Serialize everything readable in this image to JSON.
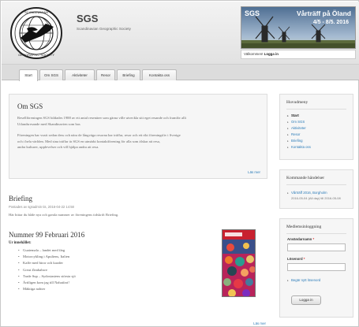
{
  "header": {
    "site_name": "SGS",
    "site_slogan": "Scandinavian Geographic Society",
    "logo_icon": "sgs-globe-logo",
    "banner": {
      "label": "SGS",
      "title": "Vårträff på Öland",
      "date": "4/5 - 8/5. 2016"
    },
    "welcome_text": "Välkommen!",
    "login_text": "Logga in"
  },
  "tabs": [
    {
      "label": "Start",
      "active": true
    },
    {
      "label": "Om SGS",
      "active": false
    },
    {
      "label": "Aktiviteter",
      "active": false
    },
    {
      "label": "Resor",
      "active": false
    },
    {
      "label": "Briefing",
      "active": false
    },
    {
      "label": "Kontakta oss",
      "active": false
    }
  ],
  "about": {
    "title": "Om SGS",
    "paragraph1": [
      "Resellföreningen SGS bildades 1988 av ett antal resenärer som gärna ville utveckla sitt eget resande och framför allt",
      "Utlandsresande med Skandinavien som bas"
    ],
    "paragraph2": [
      "Föreningen har vuxit sedan dess och nära de långväga resorna har träffar, resor och ett rikt föreningsliv i Sverige",
      "och i hela världen. Med sina träffar är SGS en utmärkt kontaktförening för alla som älskar att resa,",
      "andra kulturer, upplevelser och vill hjälpa andra att resa."
    ],
    "more_link": "Läs mer"
  },
  "briefing": {
    "title": "Briefing",
    "meta": "Postades av sgsadmin tis, 2016-04-22 14:58",
    "text": "Här hittar du både nya och gamla nummer av föreningens tidskrift Briefing."
  },
  "issue": {
    "title": "Nummer 99 Februari 2016",
    "subhead": "Ur innehållet:",
    "items": [
      "Guatemala – landet med färg",
      "Motorcykling i Apuliens, Italien",
      "Kaffe med biror och kaoder",
      "Great Zimbabwe",
      "Trade Sup – Sydostasiens största sjö",
      "Ärtiligen kom jag till Nahatfari!",
      "Mäktiga nohter"
    ],
    "cover_icon": "magazine-cover-image",
    "more_link": "Läs mer"
  },
  "sidebar": {
    "nav": {
      "title": "Huvudmeny",
      "items": [
        {
          "label": "Start",
          "active": true
        },
        {
          "label": "Om SGS",
          "active": false
        },
        {
          "label": "Aktiviteter",
          "active": false
        },
        {
          "label": "Resor",
          "active": false
        },
        {
          "label": "Briefing",
          "active": false
        },
        {
          "label": "Kontakta oss",
          "active": false
        }
      ]
    },
    "events": {
      "title": "Kommande händelser",
      "link": "Vårträff 2016, Borgholm",
      "date": "2016-05-04 (All day) till 2016-05-08"
    },
    "login": {
      "title": "Medlemsinloggning",
      "username_label": "Användarnamn",
      "password_label": "Lösenord",
      "required_marker": "*",
      "new_account": "Begär nytt lösenord",
      "button": "Logga in"
    }
  },
  "colors": {
    "link": "#2a7bb8",
    "box_bg": "#f6f6f6",
    "header_bg": "#e8e8e8"
  }
}
